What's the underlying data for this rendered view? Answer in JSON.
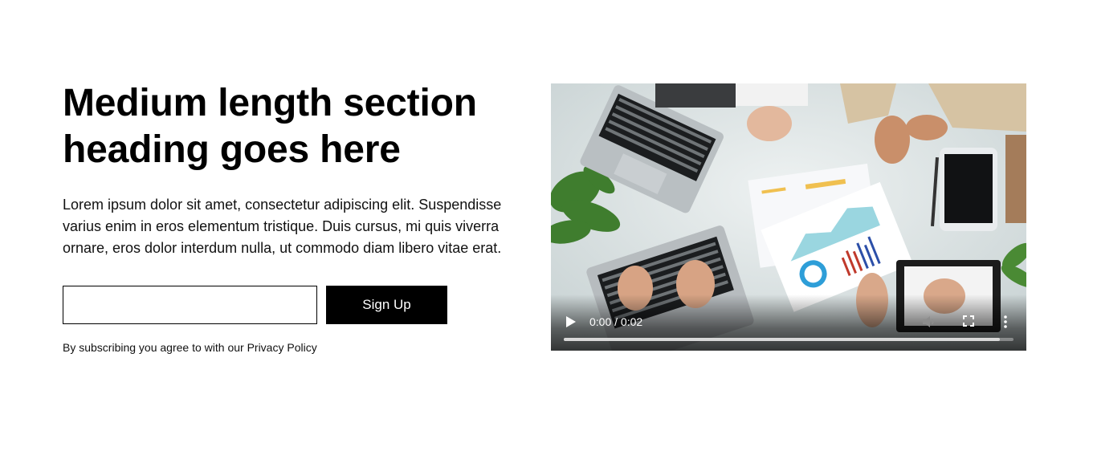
{
  "section": {
    "heading": "Medium length section heading goes here",
    "body": "Lorem ipsum dolor sit amet, consectetur adipiscing elit. Suspendisse varius enim in eros elementum tristique. Duis cursus, mi quis viverra ornare, eros dolor interdum nulla, ut commodo diam libero vitae erat.",
    "form": {
      "email_value": "",
      "email_placeholder": "",
      "signup_label": "Sign Up"
    },
    "legal_text": "By subscribing you agree to with our Privacy Policy"
  },
  "video": {
    "time_display": "0:00 / 0:02",
    "progress_fraction": 0.97,
    "icons": {
      "play": "play-icon",
      "volume": "volume-icon",
      "fullscreen": "fullscreen-icon",
      "more": "more-vertical-icon"
    }
  },
  "colors": {
    "button_bg": "#000000",
    "button_text": "#ffffff",
    "text": "#000000"
  }
}
